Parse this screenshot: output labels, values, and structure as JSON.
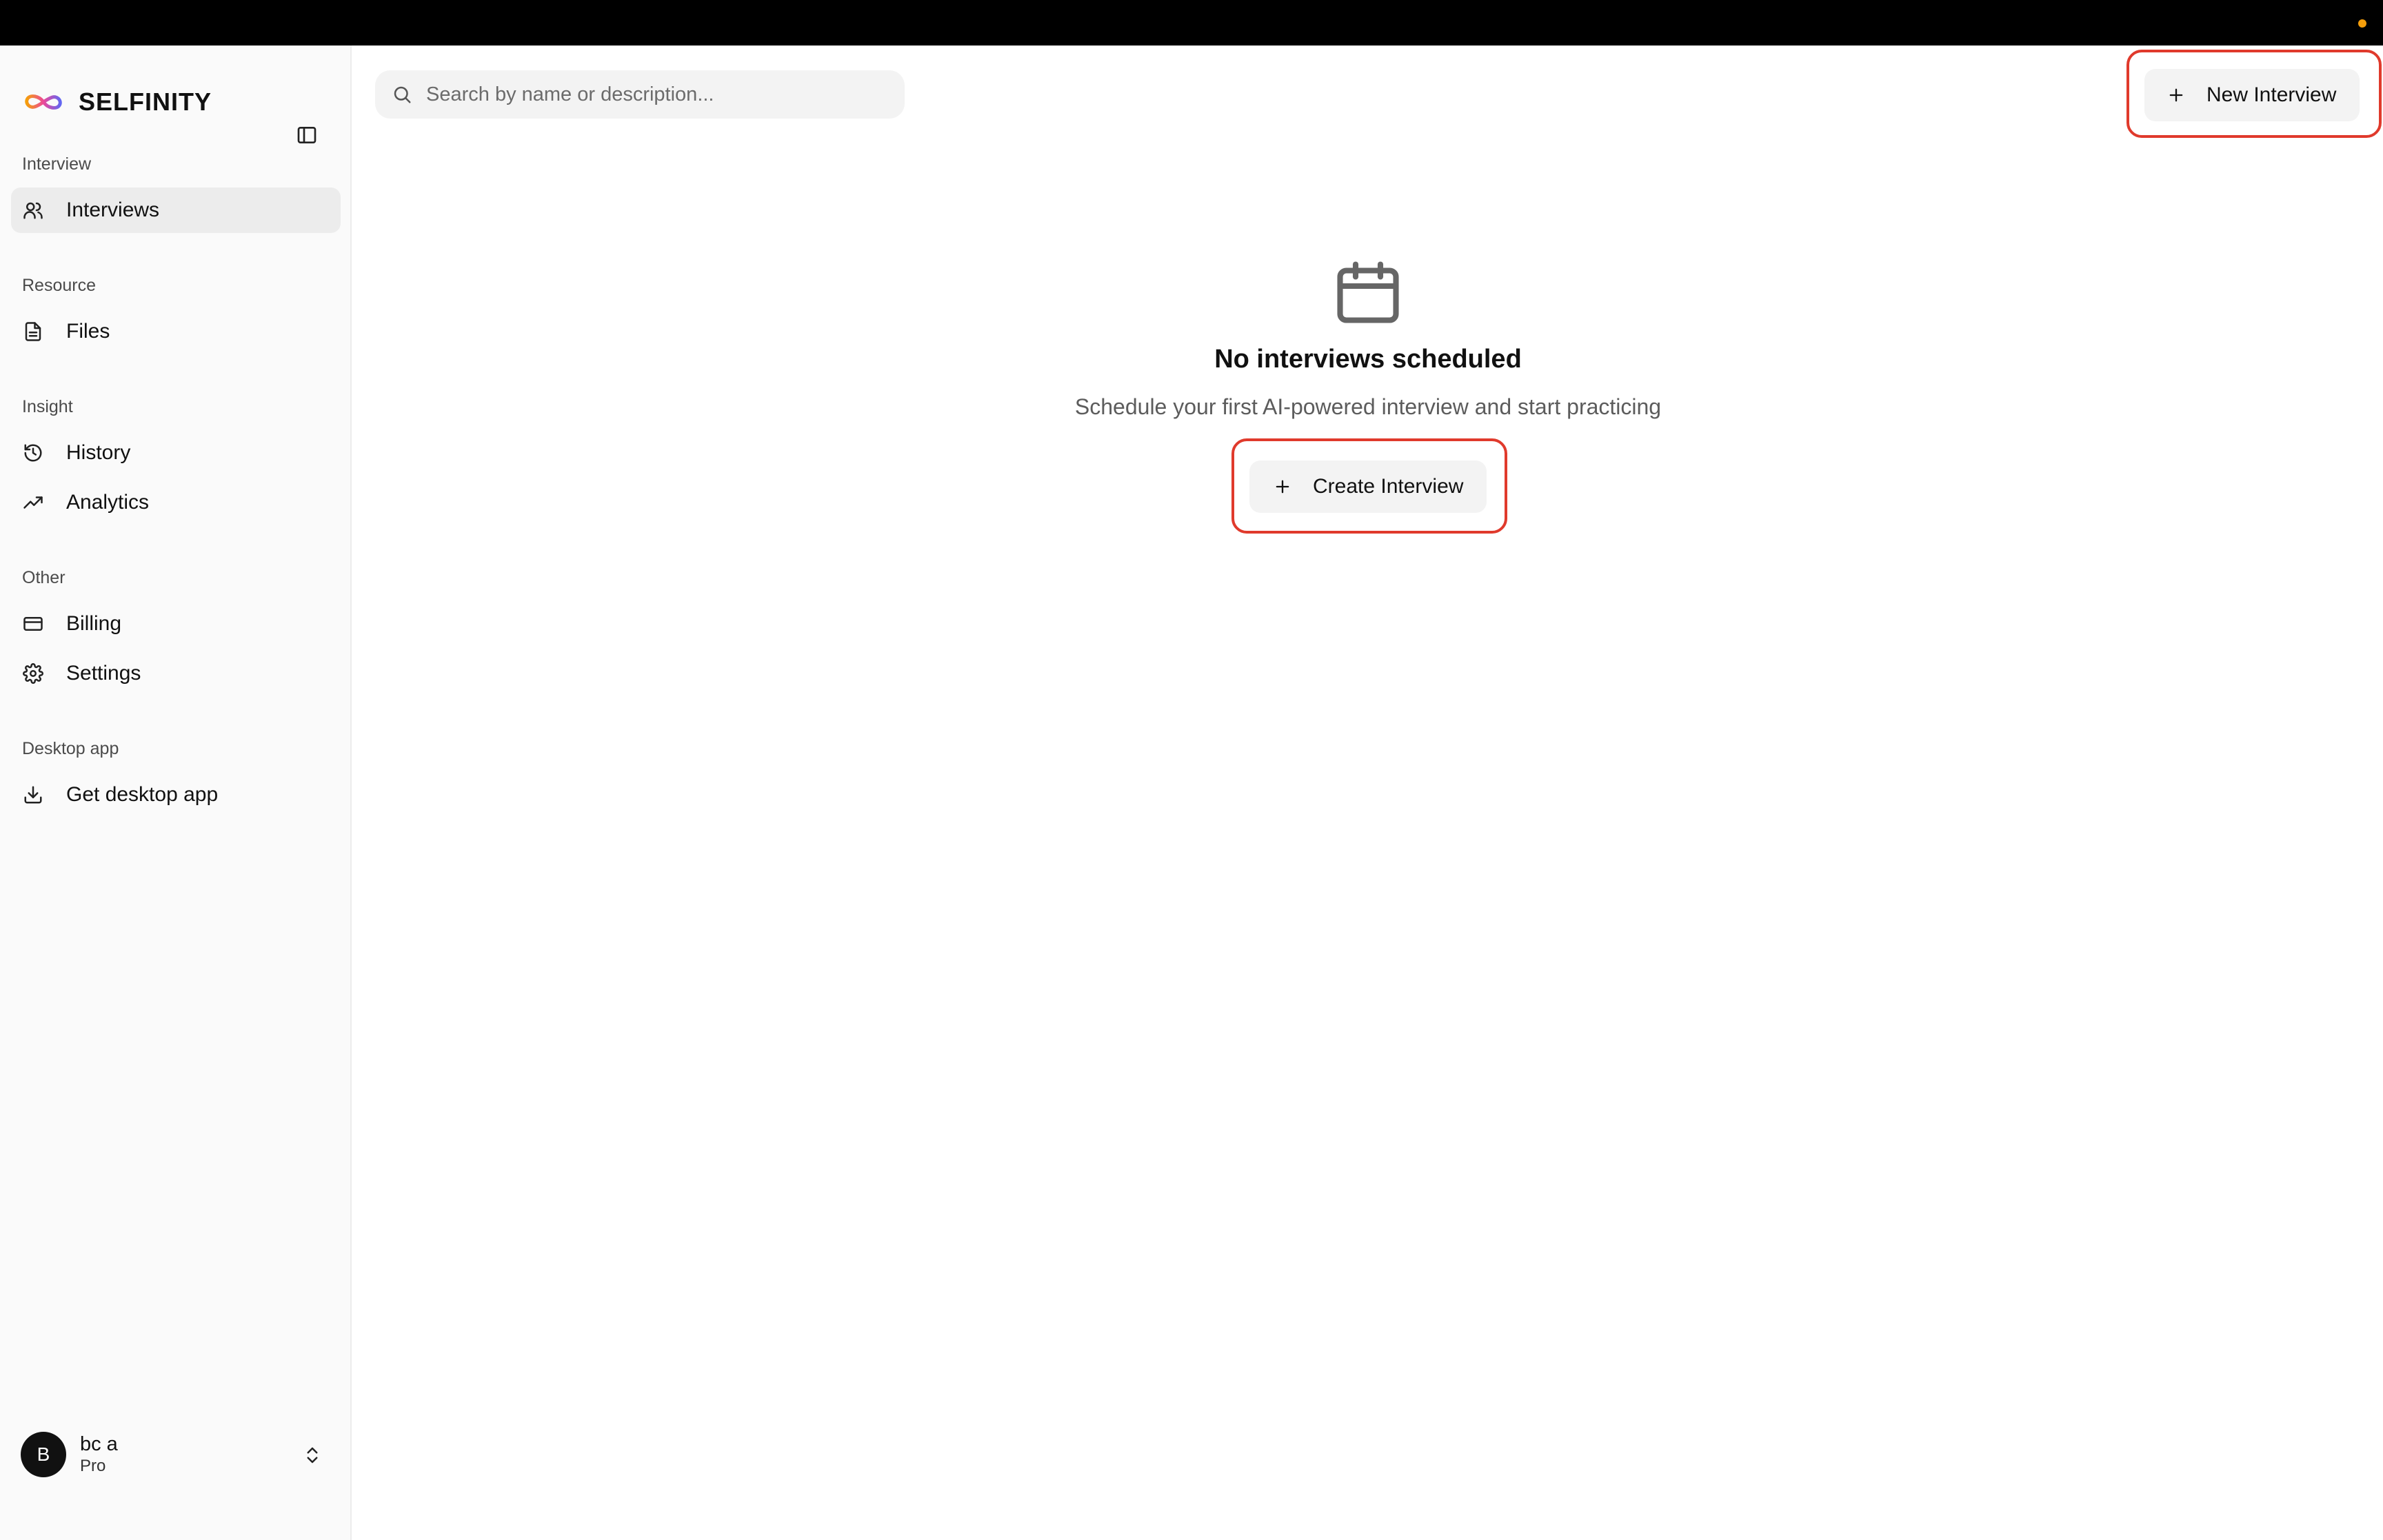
{
  "brand": {
    "name": "SELFINITY",
    "icon": "infinity-logo-icon"
  },
  "sidebar": {
    "sections": [
      {
        "label": "Interview",
        "items": [
          {
            "label": "Interviews",
            "icon": "users-icon",
            "active": true
          }
        ]
      },
      {
        "label": "Resource",
        "items": [
          {
            "label": "Files",
            "icon": "file-text-icon"
          }
        ]
      },
      {
        "label": "Insight",
        "items": [
          {
            "label": "History",
            "icon": "history-icon"
          },
          {
            "label": "Analytics",
            "icon": "trending-up-icon"
          }
        ]
      },
      {
        "label": "Other",
        "items": [
          {
            "label": "Billing",
            "icon": "credit-card-icon"
          },
          {
            "label": "Settings",
            "icon": "gear-icon"
          }
        ]
      },
      {
        "label": "Desktop app",
        "items": [
          {
            "label": "Get desktop app",
            "icon": "download-icon"
          }
        ]
      }
    ]
  },
  "user": {
    "initial": "B",
    "name": "bc a",
    "plan": "Pro"
  },
  "search": {
    "placeholder": "Search by name or description..."
  },
  "header": {
    "new_interview_label": "New Interview"
  },
  "empty_state": {
    "icon": "calendar-icon",
    "title": "No interviews scheduled",
    "subtitle": "Schedule your first AI-powered interview and start practicing",
    "button_label": "Create Interview"
  },
  "colors": {
    "highlight": "#e03a2c",
    "status_dot": "#f59e0b",
    "brand_gradient": [
      "#f59e0b",
      "#ec4899",
      "#6366f1"
    ]
  }
}
